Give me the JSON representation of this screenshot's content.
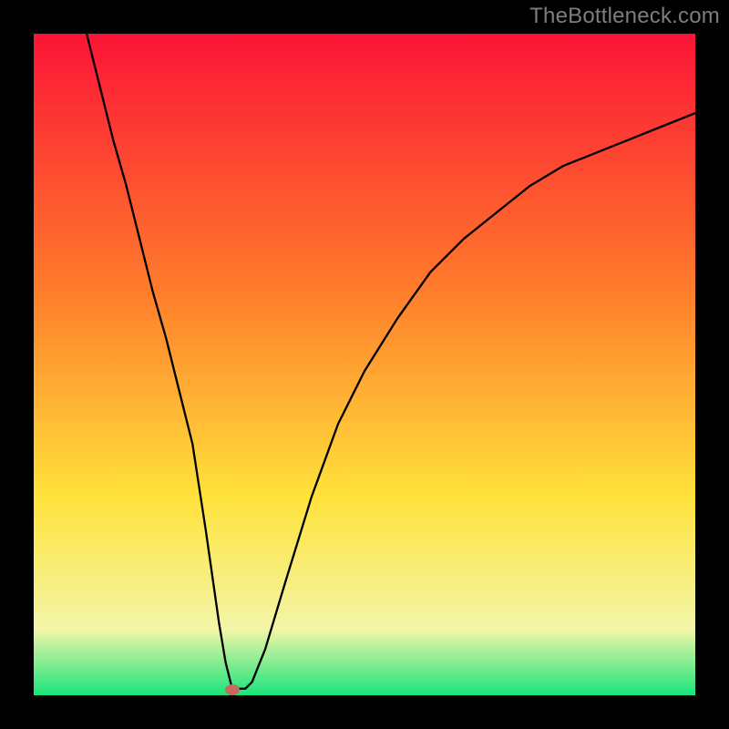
{
  "watermark": "TheBottleneck.com",
  "colors": {
    "frame": "#000000",
    "curve": "#000000",
    "marker": "#c66a5f",
    "watermark": "#7d7d7d",
    "gradient_top": "#fb1437",
    "gradient_mid1": "#ff7a2b",
    "gradient_mid2": "#ffe23b",
    "gradient_low": "#f3f6a8",
    "gradient_bottom": "#19e47c"
  },
  "chart_data": {
    "type": "line",
    "title": "",
    "xlabel": "",
    "ylabel": "",
    "xlim": [
      0,
      100
    ],
    "ylim": [
      0,
      100
    ],
    "grid": false,
    "legend": false,
    "series": [
      {
        "name": "curve",
        "x": [
          8,
          10,
          12,
          14,
          16,
          18,
          20,
          22,
          24,
          26,
          27,
          28,
          29,
          30,
          31,
          32,
          33,
          35,
          38,
          42,
          46,
          50,
          55,
          60,
          65,
          70,
          75,
          80,
          85,
          90,
          95,
          100
        ],
        "y": [
          100,
          92,
          84,
          77,
          69,
          61,
          54,
          46,
          38,
          25,
          18,
          11,
          5,
          1,
          1,
          1,
          2,
          7,
          17,
          30,
          41,
          49,
          57,
          64,
          69,
          73,
          77,
          80,
          82,
          84,
          86,
          88
        ]
      }
    ],
    "annotations": [
      {
        "name": "min-marker",
        "x": 30,
        "y": 0.8,
        "shape": "ellipse",
        "color": "#c66a5f"
      }
    ]
  }
}
